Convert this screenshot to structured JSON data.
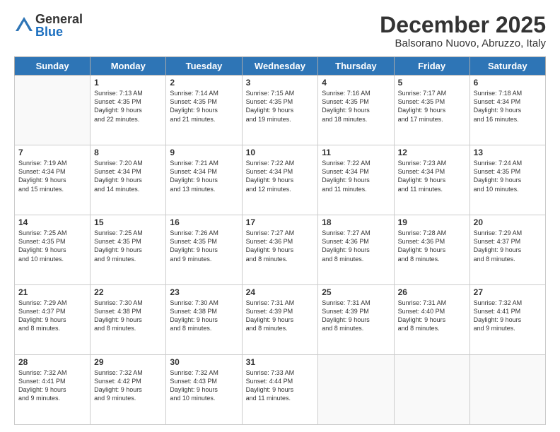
{
  "logo": {
    "general": "General",
    "blue": "Blue"
  },
  "title": "December 2025",
  "location": "Balsorano Nuovo, Abruzzo, Italy",
  "days_of_week": [
    "Sunday",
    "Monday",
    "Tuesday",
    "Wednesday",
    "Thursday",
    "Friday",
    "Saturday"
  ],
  "weeks": [
    [
      {
        "num": "",
        "info": ""
      },
      {
        "num": "1",
        "info": "Sunrise: 7:13 AM\nSunset: 4:35 PM\nDaylight: 9 hours\nand 22 minutes."
      },
      {
        "num": "2",
        "info": "Sunrise: 7:14 AM\nSunset: 4:35 PM\nDaylight: 9 hours\nand 21 minutes."
      },
      {
        "num": "3",
        "info": "Sunrise: 7:15 AM\nSunset: 4:35 PM\nDaylight: 9 hours\nand 19 minutes."
      },
      {
        "num": "4",
        "info": "Sunrise: 7:16 AM\nSunset: 4:35 PM\nDaylight: 9 hours\nand 18 minutes."
      },
      {
        "num": "5",
        "info": "Sunrise: 7:17 AM\nSunset: 4:35 PM\nDaylight: 9 hours\nand 17 minutes."
      },
      {
        "num": "6",
        "info": "Sunrise: 7:18 AM\nSunset: 4:34 PM\nDaylight: 9 hours\nand 16 minutes."
      }
    ],
    [
      {
        "num": "7",
        "info": "Sunrise: 7:19 AM\nSunset: 4:34 PM\nDaylight: 9 hours\nand 15 minutes."
      },
      {
        "num": "8",
        "info": "Sunrise: 7:20 AM\nSunset: 4:34 PM\nDaylight: 9 hours\nand 14 minutes."
      },
      {
        "num": "9",
        "info": "Sunrise: 7:21 AM\nSunset: 4:34 PM\nDaylight: 9 hours\nand 13 minutes."
      },
      {
        "num": "10",
        "info": "Sunrise: 7:22 AM\nSunset: 4:34 PM\nDaylight: 9 hours\nand 12 minutes."
      },
      {
        "num": "11",
        "info": "Sunrise: 7:22 AM\nSunset: 4:34 PM\nDaylight: 9 hours\nand 11 minutes."
      },
      {
        "num": "12",
        "info": "Sunrise: 7:23 AM\nSunset: 4:34 PM\nDaylight: 9 hours\nand 11 minutes."
      },
      {
        "num": "13",
        "info": "Sunrise: 7:24 AM\nSunset: 4:35 PM\nDaylight: 9 hours\nand 10 minutes."
      }
    ],
    [
      {
        "num": "14",
        "info": "Sunrise: 7:25 AM\nSunset: 4:35 PM\nDaylight: 9 hours\nand 10 minutes."
      },
      {
        "num": "15",
        "info": "Sunrise: 7:25 AM\nSunset: 4:35 PM\nDaylight: 9 hours\nand 9 minutes."
      },
      {
        "num": "16",
        "info": "Sunrise: 7:26 AM\nSunset: 4:35 PM\nDaylight: 9 hours\nand 9 minutes."
      },
      {
        "num": "17",
        "info": "Sunrise: 7:27 AM\nSunset: 4:36 PM\nDaylight: 9 hours\nand 8 minutes."
      },
      {
        "num": "18",
        "info": "Sunrise: 7:27 AM\nSunset: 4:36 PM\nDaylight: 9 hours\nand 8 minutes."
      },
      {
        "num": "19",
        "info": "Sunrise: 7:28 AM\nSunset: 4:36 PM\nDaylight: 9 hours\nand 8 minutes."
      },
      {
        "num": "20",
        "info": "Sunrise: 7:29 AM\nSunset: 4:37 PM\nDaylight: 9 hours\nand 8 minutes."
      }
    ],
    [
      {
        "num": "21",
        "info": "Sunrise: 7:29 AM\nSunset: 4:37 PM\nDaylight: 9 hours\nand 8 minutes."
      },
      {
        "num": "22",
        "info": "Sunrise: 7:30 AM\nSunset: 4:38 PM\nDaylight: 9 hours\nand 8 minutes."
      },
      {
        "num": "23",
        "info": "Sunrise: 7:30 AM\nSunset: 4:38 PM\nDaylight: 9 hours\nand 8 minutes."
      },
      {
        "num": "24",
        "info": "Sunrise: 7:31 AM\nSunset: 4:39 PM\nDaylight: 9 hours\nand 8 minutes."
      },
      {
        "num": "25",
        "info": "Sunrise: 7:31 AM\nSunset: 4:39 PM\nDaylight: 9 hours\nand 8 minutes."
      },
      {
        "num": "26",
        "info": "Sunrise: 7:31 AM\nSunset: 4:40 PM\nDaylight: 9 hours\nand 8 minutes."
      },
      {
        "num": "27",
        "info": "Sunrise: 7:32 AM\nSunset: 4:41 PM\nDaylight: 9 hours\nand 9 minutes."
      }
    ],
    [
      {
        "num": "28",
        "info": "Sunrise: 7:32 AM\nSunset: 4:41 PM\nDaylight: 9 hours\nand 9 minutes."
      },
      {
        "num": "29",
        "info": "Sunrise: 7:32 AM\nSunset: 4:42 PM\nDaylight: 9 hours\nand 9 minutes."
      },
      {
        "num": "30",
        "info": "Sunrise: 7:32 AM\nSunset: 4:43 PM\nDaylight: 9 hours\nand 10 minutes."
      },
      {
        "num": "31",
        "info": "Sunrise: 7:33 AM\nSunset: 4:44 PM\nDaylight: 9 hours\nand 11 minutes."
      },
      {
        "num": "",
        "info": ""
      },
      {
        "num": "",
        "info": ""
      },
      {
        "num": "",
        "info": ""
      }
    ]
  ]
}
